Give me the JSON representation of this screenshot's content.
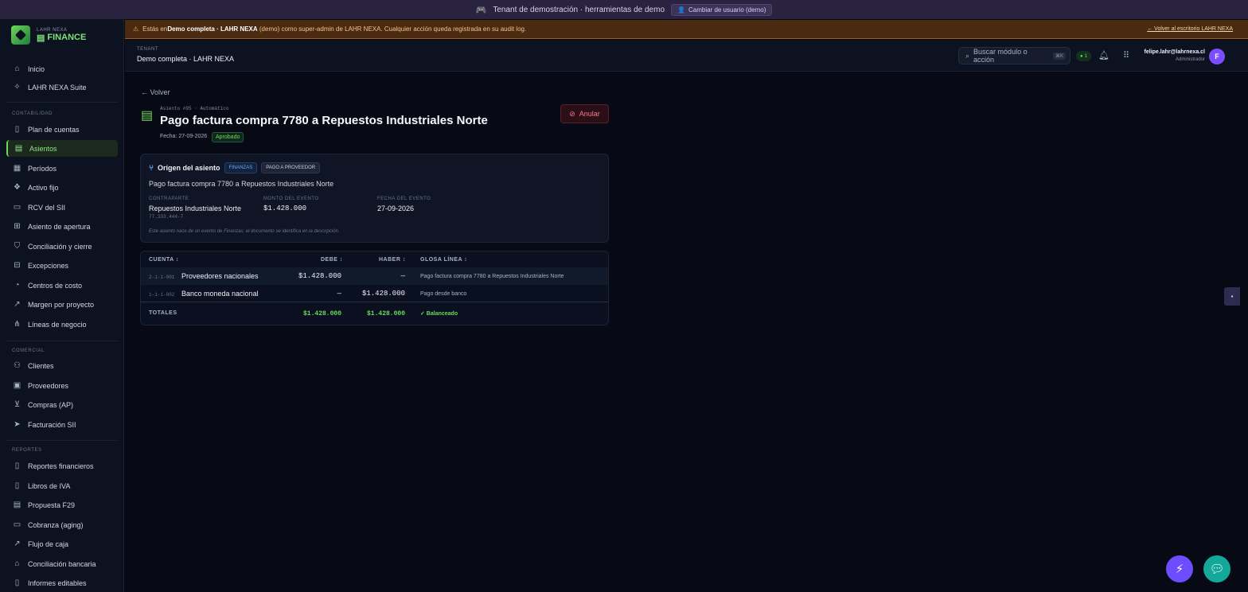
{
  "topbar": {
    "demo_text": "Tenant de demostración · herramientas de demo",
    "switch_user": "Cambiar de usuario (demo)"
  },
  "sidebar": {
    "brand_sub": "LAHR NEXA",
    "brand_title": "FINANCE",
    "top_items": [
      {
        "label": "Inicio",
        "icon": "home-icon"
      },
      {
        "label": "LAHR NEXA Suite",
        "icon": "sparkles-icon"
      }
    ],
    "sections": [
      {
        "title": "CONTABILIDAD",
        "items": [
          {
            "label": "Plan de cuentas",
            "icon": "book-icon"
          },
          {
            "label": "Asientos",
            "icon": "receipt-icon",
            "active": true
          },
          {
            "label": "Períodos",
            "icon": "calendar-icon"
          },
          {
            "label": "Activo fijo",
            "icon": "boxes-icon"
          },
          {
            "label": "RCV del SII",
            "icon": "file-icon"
          },
          {
            "label": "Asiento de apertura",
            "icon": "file-plus-icon"
          },
          {
            "label": "Conciliación y cierre",
            "icon": "shield-check-icon"
          },
          {
            "label": "Excepciones",
            "icon": "inbox-icon"
          },
          {
            "label": "Centros de costo",
            "icon": "pie-chart-icon"
          },
          {
            "label": "Margen por proyecto",
            "icon": "trending-up-icon"
          },
          {
            "label": "Líneas de negocio",
            "icon": "network-icon"
          }
        ]
      },
      {
        "title": "COMERCIAL",
        "items": [
          {
            "label": "Clientes",
            "icon": "users-icon"
          },
          {
            "label": "Proveedores",
            "icon": "package-icon"
          },
          {
            "label": "Compras (AP)",
            "icon": "cart-icon"
          },
          {
            "label": "Facturación SII",
            "icon": "send-icon"
          }
        ]
      },
      {
        "title": "REPORTES",
        "items": [
          {
            "label": "Reportes financieros",
            "icon": "book-open-icon"
          },
          {
            "label": "Libros de IVA",
            "icon": "book-icon"
          },
          {
            "label": "Propuesta F29",
            "icon": "file-text-icon"
          },
          {
            "label": "Cobranza (aging)",
            "icon": "wallet-icon"
          },
          {
            "label": "Flujo de caja",
            "icon": "trending-up-icon"
          },
          {
            "label": "Conciliación bancaria",
            "icon": "bank-icon"
          },
          {
            "label": "Informes editables",
            "icon": "book-open-icon"
          }
        ]
      }
    ]
  },
  "banner": {
    "prefix": "Estás en ",
    "tenant": "Demo completa · LAHR NEXA",
    "demo": " (demo) ",
    "suffix": "como super-admin de LAHR NEXA. Cualquier acción queda registrada en su audit log.",
    "back_link": "← Volver al escritorio LAHR NEXA"
  },
  "header": {
    "tenant_label": "TENANT",
    "tenant_name": "Demo completa · LAHR NEXA",
    "search_placeholder": "Buscar módulo o acción",
    "search_kbd": "⌘K",
    "online_count": "1",
    "user_email": "felipe.lahr@lahrnexa.cl",
    "user_role": "Administrador",
    "avatar_initial": "F"
  },
  "entry": {
    "back": "← Volver",
    "eyebrow": "Asiento #95 · Automático",
    "title": "Pago factura compra 7780 a Repuestos Industriales Norte",
    "date": "Fecha: 27-09-2026",
    "status": "Aprobado",
    "void_button": "Anular"
  },
  "origin": {
    "title": "Origen del asiento",
    "tags": [
      "FINANZAS",
      "PAGO A PROVEEDOR"
    ],
    "description": "Pago factura compra 7780 a Repuestos Industriales Norte",
    "counterparty_label": "CONTRAPARTE",
    "counterparty": "Repuestos Industriales Norte",
    "counterparty_rut": "77.333.444-7",
    "amount_label": "MONTO DEL EVENTO",
    "amount": "$1.428.000",
    "event_date_label": "FECHA DEL EVENTO",
    "event_date": "27-09-2026",
    "note": "Este asiento nace de un evento de Finanzas; el documento se identifica en la descripción."
  },
  "lines": {
    "headers": {
      "account": "CUENTA ↕",
      "debit": "DEBE ↕",
      "credit": "HABER ↕",
      "gloss": "GLOSA LÍNEA ↕"
    },
    "rows": [
      {
        "code": "2-1-1-001",
        "account": "Proveedores nacionales",
        "debit": "$1.428.000",
        "credit": "—",
        "gloss": "Pago factura compra 7780 a Repuestos Industriales Norte"
      },
      {
        "code": "1-1-1-002",
        "account": "Banco moneda nacional",
        "debit": "—",
        "credit": "$1.428.000",
        "gloss": "Pago desde banco"
      }
    ],
    "totals": {
      "label": "TOTALES",
      "debit": "$1.428.000",
      "credit": "$1.428.000",
      "status": "✓ Balanceado"
    }
  }
}
